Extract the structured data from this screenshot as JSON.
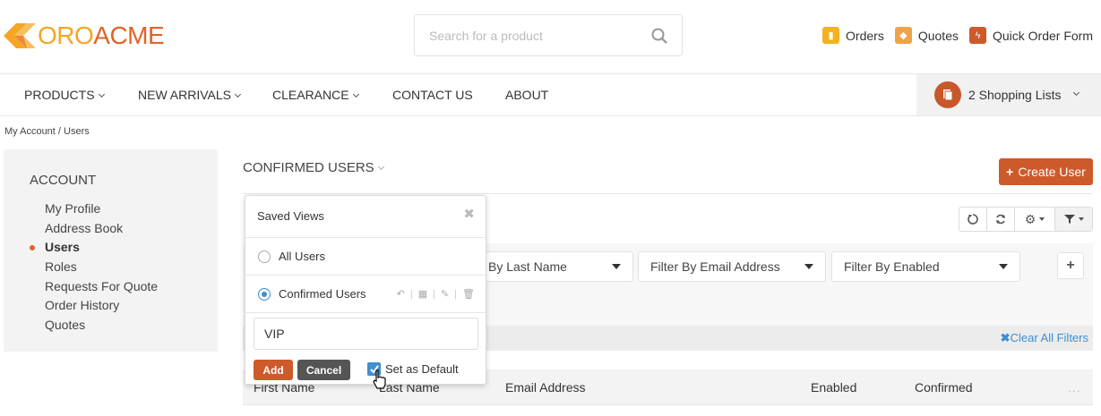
{
  "brand": {
    "oro": "ORO",
    "acme": "ACME"
  },
  "search": {
    "placeholder": "Search for a product"
  },
  "top_links": [
    {
      "label": "Orders",
      "icon": "orders-icon",
      "color": "#f5b21c"
    },
    {
      "label": "Quotes",
      "icon": "quotes-icon",
      "color": "#f0a24a"
    },
    {
      "label": "Quick Order Form",
      "icon": "quick-order-icon",
      "color": "#cd5a2b"
    }
  ],
  "nav": {
    "items": [
      "PRODUCTS",
      "NEW ARRIVALS",
      "CLEARANCE",
      "CONTACT US",
      "ABOUT"
    ],
    "shopping_lists": "2 Shopping Lists"
  },
  "breadcrumb": "My Account / Users",
  "sidebar": {
    "title": "ACCOUNT",
    "items": [
      "My Profile",
      "Address Book",
      "Users",
      "Roles",
      "Requests For Quote",
      "Order History",
      "Quotes"
    ],
    "active_index": 2
  },
  "page": {
    "title": "CONFIRMED USERS",
    "create_button": "Create User"
  },
  "filters": {
    "last_name": "By Last Name",
    "email": "Filter By Email Address",
    "enabled": "Filter By Enabled",
    "clear_all": "Clear All Filters"
  },
  "table": {
    "columns": [
      "First Name",
      "Last Name",
      "Email Address",
      "Enabled",
      "Confirmed"
    ],
    "more": "..."
  },
  "saved_views": {
    "title": "Saved Views",
    "views": [
      {
        "label": "All Users",
        "checked": false
      },
      {
        "label": "Confirmed Users",
        "checked": true
      }
    ],
    "new_view_value": "VIP",
    "add_button": "Add",
    "cancel_button": "Cancel",
    "set_default_label": "Set as Default",
    "set_default_checked": true
  },
  "colors": {
    "accent": "#cd5a2b",
    "link": "#3b8ed3"
  }
}
